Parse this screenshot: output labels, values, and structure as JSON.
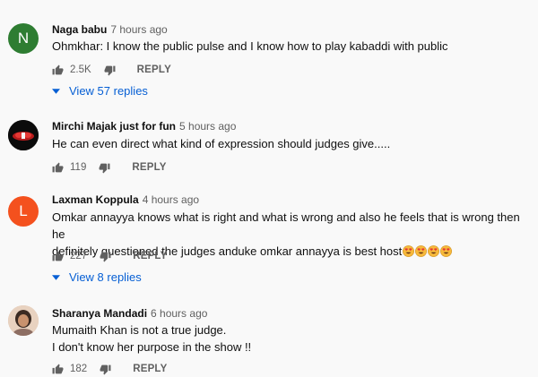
{
  "comments": [
    {
      "author": "Naga babu",
      "time": "7 hours ago",
      "avatar_letter": "N",
      "avatar_color": "#2e7d32",
      "lines": [
        "Ohmkhar: I know the public pulse and I know how to play kabaddi with public"
      ],
      "likes": "2.5K",
      "reply_label": "REPLY",
      "view_replies": "View 57 replies"
    },
    {
      "author": "Mirchi Majak just for fun",
      "time": "5 hours ago",
      "avatar_letter": "",
      "avatar_color": "#111111",
      "lines": [
        "He can even direct what kind of expression should judges give....."
      ],
      "likes": "119",
      "reply_label": "REPLY",
      "view_replies": ""
    },
    {
      "author": "Laxman Koppula",
      "time": "4 hours ago",
      "avatar_letter": "L",
      "avatar_color": "#f4511e",
      "lines": [
        "Omkar annayya knows what is right and what is wrong and also he feels that is wrong then he",
        "definitely questioned the judges anduke omkar annayya is best host"
      ],
      "emoji_count": 4,
      "likes": "227",
      "reply_label": "REPLY",
      "view_replies": "View 8 replies"
    },
    {
      "author": "Sharanya Mandadi",
      "time": "6 hours ago",
      "avatar_letter": "",
      "avatar_color": "#d9b8a0",
      "lines": [
        "Mumaith Khan is not a true judge.",
        "I don't know her purpose in the show !!"
      ],
      "likes": "182",
      "reply_label": "REPLY",
      "view_replies": ""
    }
  ],
  "colors": {
    "link_blue": "#065fd4",
    "meta_gray": "#606060",
    "background": "#f9f9f9"
  },
  "icons": [
    "thumbs-up-icon",
    "thumbs-down-icon",
    "chevron-down-icon",
    "heart-eyes-emoji"
  ]
}
